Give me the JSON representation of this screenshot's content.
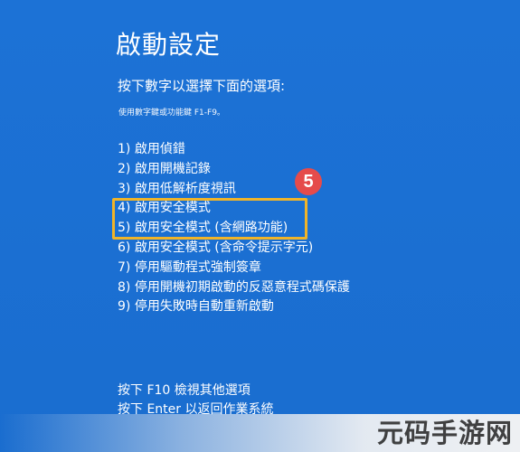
{
  "title": "啟動設定",
  "prompt": "按下數字以選擇下面的選項:",
  "hint": "使用數字鍵或功能鍵 F1-F9。",
  "options": [
    "1) 啟用偵錯",
    "2) 啟用開機記錄",
    "3) 啟用低解析度視訊",
    "4) 啟用安全模式",
    "5) 啟用安全模式 (含網路功能)",
    "6) 啟用安全模式 (含命令提示字元)",
    "7) 停用驅動程式強制簽章",
    "8) 停用開機初期啟動的反惡意程式碼保護",
    "9) 停用失敗時自動重新啟動"
  ],
  "annotation": {
    "step_number": "5",
    "highlight_color": "#f0b429",
    "badge_color": "#e54b4b"
  },
  "footer": {
    "more_options": "按下 F10 檢視其他選項",
    "return": "按下 Enter 以返回作業系統"
  },
  "watermark": "元码手游网",
  "colors": {
    "background": "#1a6fd1",
    "text": "#ffffff"
  }
}
